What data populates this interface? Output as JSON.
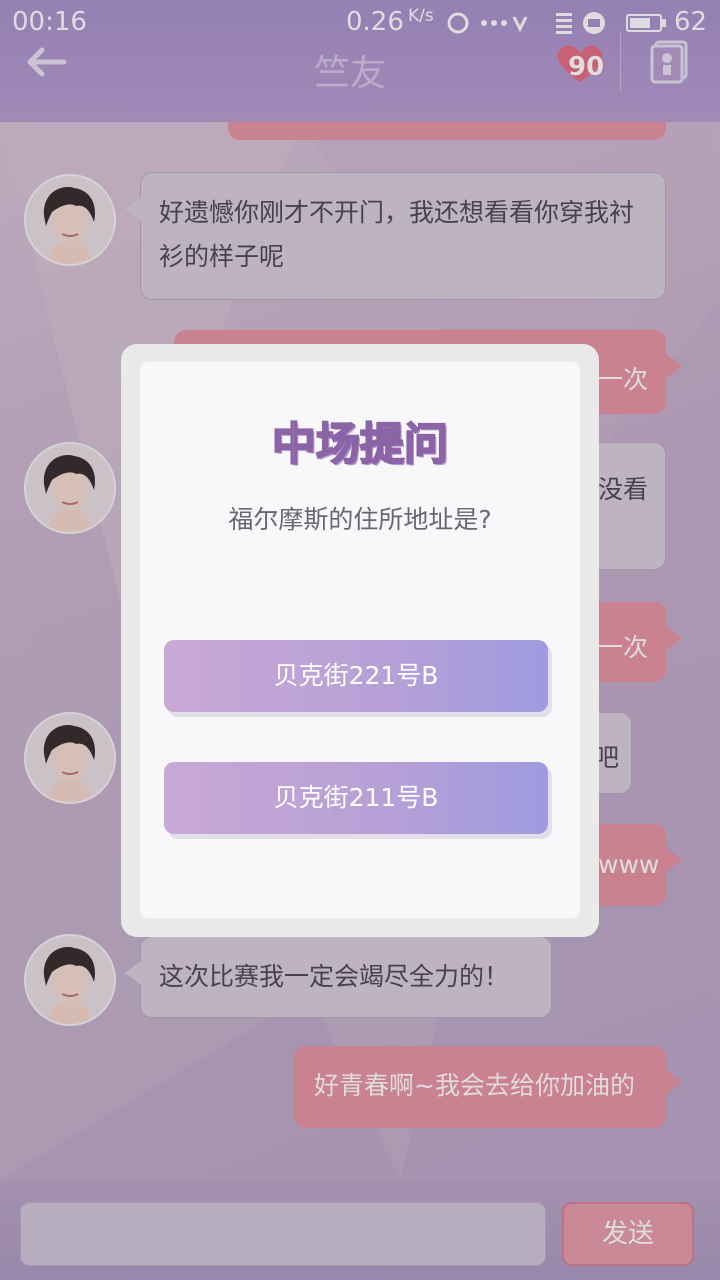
{
  "status_bar": {
    "time": "00:16",
    "speed": "0.26",
    "speed_unit": "K/s",
    "battery": "62"
  },
  "header": {
    "title": "竺友",
    "affection": "90",
    "back_icon": "arrow-left-icon",
    "contact_icon": "contact-card-icon"
  },
  "messages": [
    {
      "side": "in",
      "text": "好遗憾你刚才不开门，我还想看看你穿我衬衫的样子呢"
    },
    {
      "side": "out",
      "fragment": "一次"
    },
    {
      "side": "in",
      "fragment": "没看"
    },
    {
      "side": "out",
      "fragment": "一次"
    },
    {
      "side": "in",
      "fragment": "吧"
    },
    {
      "side": "out",
      "fragment": "www"
    },
    {
      "side": "in",
      "text": "这次比赛我一定会竭尽全力的！"
    },
    {
      "side": "out",
      "text": "好青春啊~我会去给你加油的"
    }
  ],
  "input": {
    "send_label": "发送"
  },
  "quiz": {
    "title": "中场提问",
    "question": "福尔摩斯的住所地址是?",
    "options": [
      "贝克街221号B",
      "贝克街211号B"
    ]
  },
  "colors": {
    "header": "#a58fc9",
    "bubble_out": "#e7909f",
    "bubble_in": "#d8cfdb",
    "option_gradient_start": "#c8a8d6",
    "option_gradient_end": "#9f9be0"
  }
}
